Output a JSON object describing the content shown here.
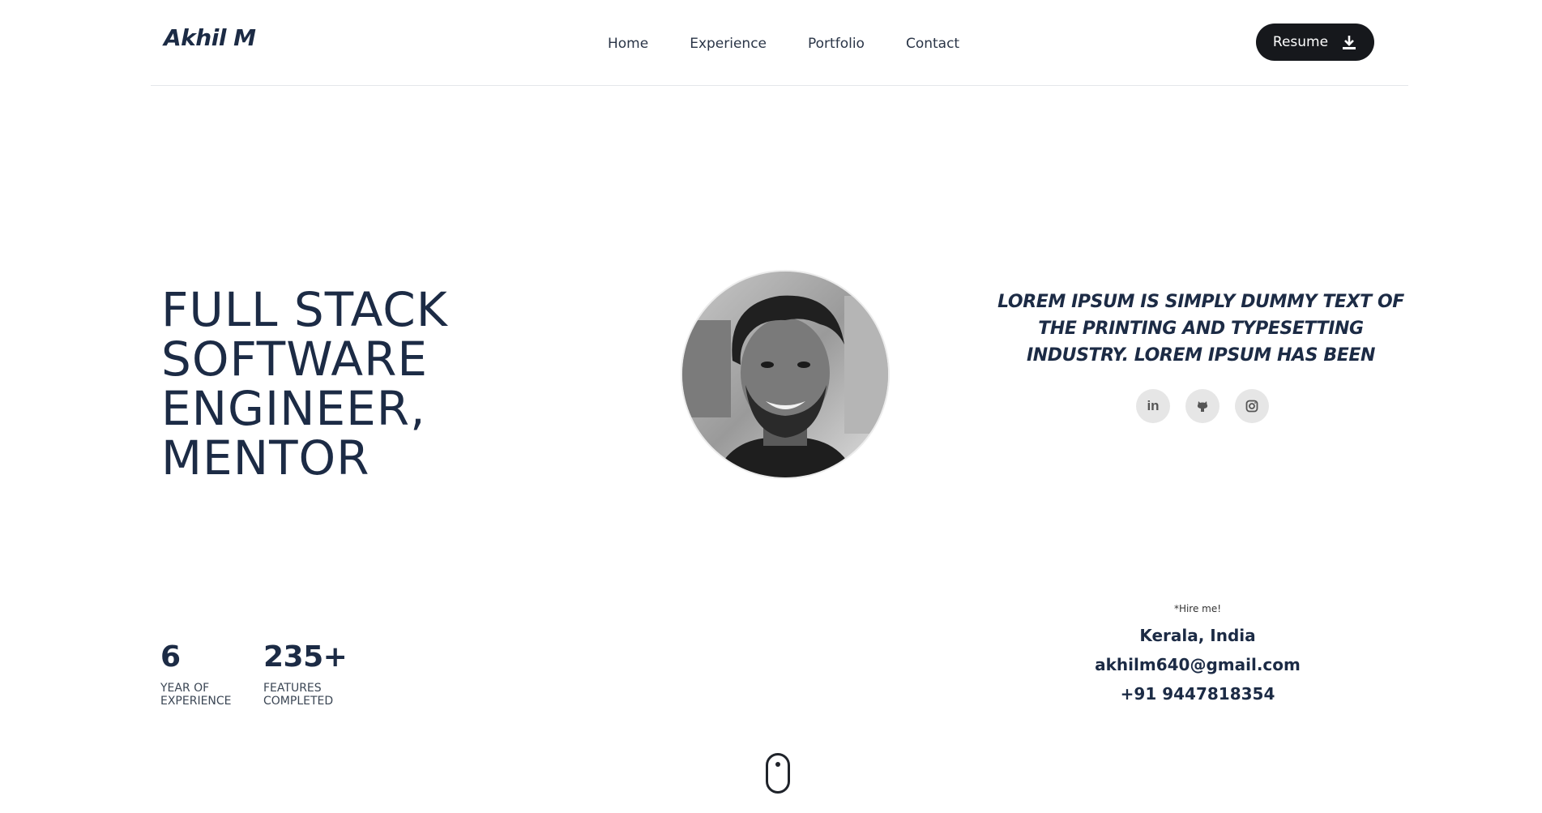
{
  "header": {
    "logo": "Akhil M",
    "nav": [
      "Home",
      "Experience",
      "Portfolio",
      "Contact"
    ],
    "resume_label": "Resume",
    "resume_icon": "download-icon"
  },
  "hero": {
    "title_lines": [
      "FULL STACK",
      "SOFTWARE",
      "ENGINEER,",
      "MENTOR"
    ],
    "tagline": "LOREM IPSUM IS SIMPLY DUMMY TEXT OF THE PRINTING AND TYPESETTING INDUSTRY. LOREM IPSUM HAS BEEN",
    "socials": [
      {
        "name": "linkedin",
        "icon": "linkedin-icon",
        "glyph": "in"
      },
      {
        "name": "github",
        "icon": "github-icon"
      },
      {
        "name": "instagram",
        "icon": "instagram-icon"
      }
    ]
  },
  "stats": [
    {
      "value": "6",
      "label": "YEAR OF\nEXPERIENCE"
    },
    {
      "value": "235+",
      "label": "FEATURES\nCOMPLETED"
    }
  ],
  "contact": {
    "hire_label": "*Hire me!",
    "location": "Kerala, India",
    "email": "akhilm640@gmail.com",
    "phone": "+91 9447818354"
  },
  "scroll_indicator": "mouse-scroll-icon",
  "colors": {
    "text": "#1c2b45",
    "button_bg": "#16181c",
    "social_bg": "#e6e6e6",
    "divider": "#e4e6ea"
  }
}
